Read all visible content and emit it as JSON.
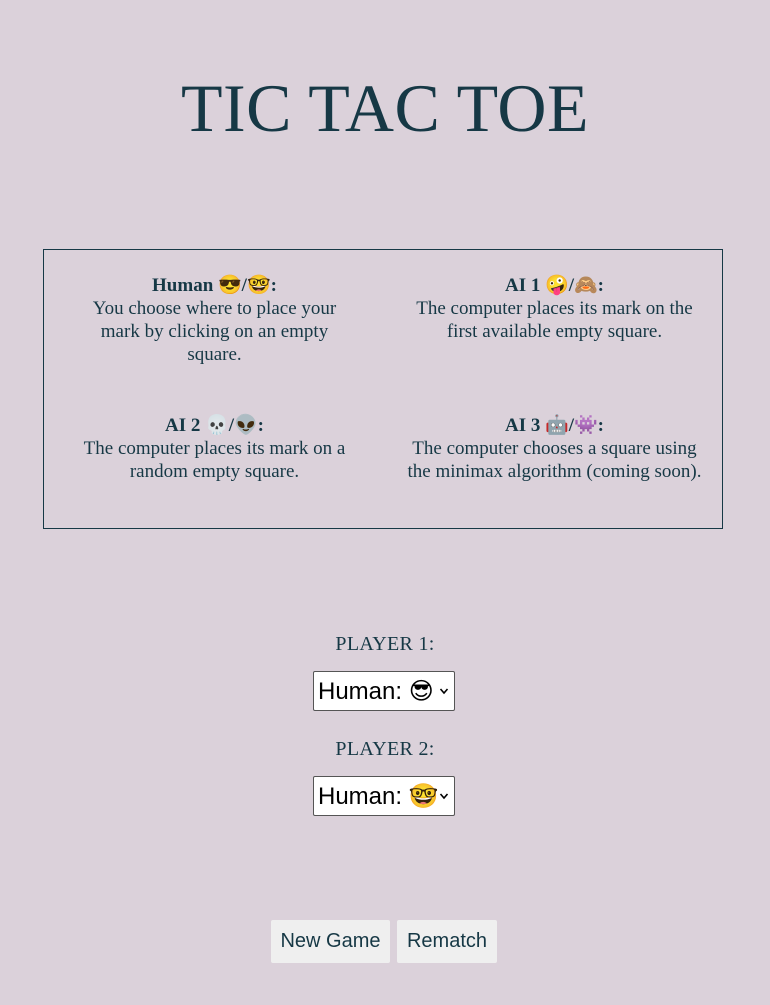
{
  "title": "TIC TAC TOE",
  "legend": [
    {
      "name": "Human 😎/🤓:",
      "desc": "You choose where to place your mark by clicking on an empty square."
    },
    {
      "name": "AI 1 🤪/🙈:",
      "desc": "The computer places its mark on the first available empty square."
    },
    {
      "name": "AI 2 💀/👽:",
      "desc": "The computer places its mark on a random empty square."
    },
    {
      "name": "AI 3 🤖/👾:",
      "desc": "The computer chooses a square using the minimax algorithm (coming soon)."
    }
  ],
  "player1": {
    "label": "PLAYER 1:",
    "selected": "Human: 😎"
  },
  "player2": {
    "label": "PLAYER 2:",
    "selected": "Human: 🤓"
  },
  "buttons": {
    "new_game": "New Game",
    "rematch": "Rematch"
  }
}
